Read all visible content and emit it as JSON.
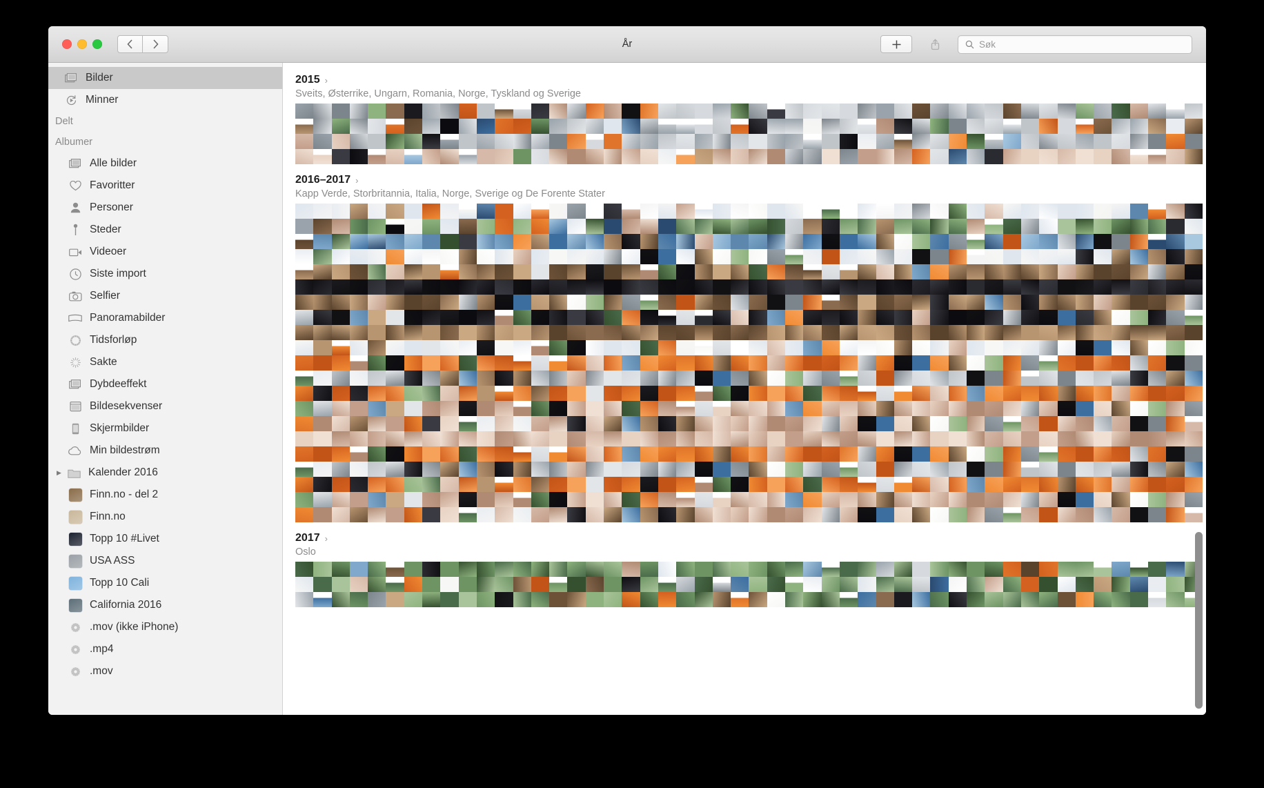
{
  "window": {
    "title": "År",
    "traffic_lights": [
      "close",
      "minimize",
      "zoom"
    ],
    "nav_back": "‹",
    "nav_forward": "›",
    "add_label": "+",
    "share_label": "share"
  },
  "search": {
    "placeholder": "Søk"
  },
  "sidebar": {
    "top_items": [
      {
        "label": "Bilder",
        "icon": "photos-icon",
        "selected": true
      },
      {
        "label": "Minner",
        "icon": "memories-icon",
        "selected": false
      }
    ],
    "shared_header": "Delt",
    "albums_header": "Albumer",
    "album_items": [
      {
        "label": "Alle bilder",
        "icon": "photos-icon"
      },
      {
        "label": "Favoritter",
        "icon": "heart-icon"
      },
      {
        "label": "Personer",
        "icon": "person-icon"
      },
      {
        "label": "Steder",
        "icon": "pin-icon"
      },
      {
        "label": "Videoer",
        "icon": "video-icon"
      },
      {
        "label": "Siste import",
        "icon": "clock-icon"
      },
      {
        "label": "Selfier",
        "icon": "camera-icon"
      },
      {
        "label": "Panoramabilder",
        "icon": "panorama-icon"
      },
      {
        "label": "Tidsforløp",
        "icon": "timelapse-icon"
      },
      {
        "label": "Sakte",
        "icon": "slomo-icon"
      },
      {
        "label": "Dybdeeffekt",
        "icon": "depth-icon"
      },
      {
        "label": "Bildesekvenser",
        "icon": "burst-icon"
      },
      {
        "label": "Skjermbilder",
        "icon": "screenshot-icon"
      },
      {
        "label": "Min bildestrøm",
        "icon": "cloud-icon"
      },
      {
        "label": "Kalender 2016",
        "icon": "folder-icon",
        "disclosure": "▶"
      },
      {
        "label": "Finn.no - del 2",
        "icon": "album-thumb",
        "thumb": "#8a6d4a"
      },
      {
        "label": "Finn.no",
        "icon": "album-thumb",
        "thumb": "#c9b79a"
      },
      {
        "label": "Topp 10 #Livet",
        "icon": "album-thumb",
        "thumb": "#1c2230"
      },
      {
        "label": "USA ASS",
        "icon": "album-thumb",
        "thumb": "#9aa0a6"
      },
      {
        "label": "Topp 10 Cali",
        "icon": "album-thumb",
        "thumb": "#7fb3dd"
      },
      {
        "label": "California 2016",
        "icon": "album-thumb",
        "thumb": "#5d6e78"
      },
      {
        "label": ".mov (ikke iPhone)",
        "icon": "smart-album-icon"
      },
      {
        "label": ".mp4",
        "icon": "smart-album-icon"
      },
      {
        "label": ".mov",
        "icon": "smart-album-icon"
      }
    ]
  },
  "content": {
    "sections": [
      {
        "title": "2015",
        "chevron": "›",
        "subtitle": "Sveits, Østerrike, Ungarn, Romania, Norge, Tyskland og Sverige",
        "rows": 4,
        "cols": 50,
        "seed": 11
      },
      {
        "title": "2016–2017",
        "chevron": "›",
        "subtitle": "Kapp Verde, Storbritannia, Italia, Norge, Sverige og De Forente Stater",
        "rows": 21,
        "cols": 50,
        "seed": 37
      },
      {
        "title": "2017",
        "chevron": "›",
        "subtitle": "Oslo",
        "rows": 3,
        "cols": 50,
        "seed": 73
      }
    ]
  },
  "scrollbar": {
    "top_pct": 72,
    "height_pct": 27
  }
}
